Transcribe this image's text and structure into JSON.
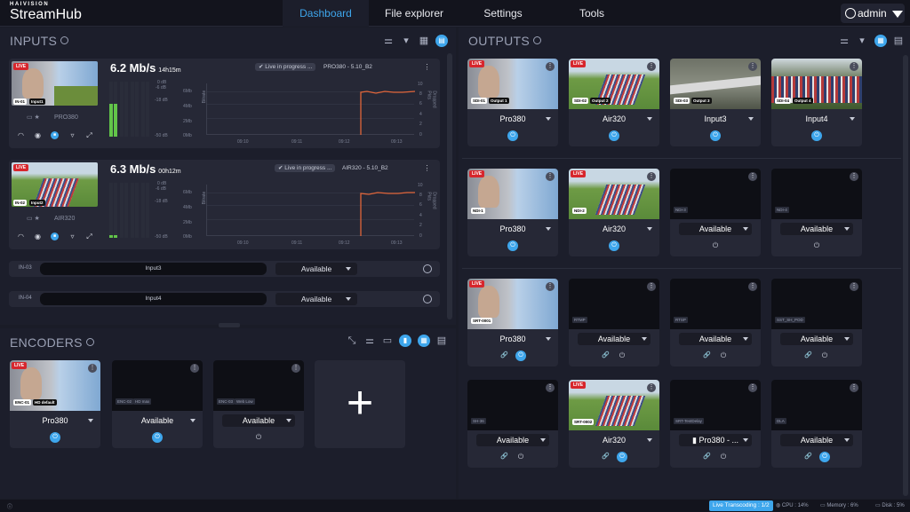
{
  "header": {
    "brand_top": "HAIVISION",
    "brand": "StreamHub",
    "tabs": [
      {
        "label": "Dashboard"
      },
      {
        "label": "File explorer"
      },
      {
        "label": "Settings"
      },
      {
        "label": "Tools"
      }
    ],
    "user": "admin"
  },
  "inputs": {
    "title": "INPUTS",
    "rows": [
      {
        "rate": "6.2 Mb/s",
        "dur": "14h15m",
        "status": "Live in progress ...",
        "device": "PRO380 - 5.10_B2",
        "id": "IN-01",
        "name": "Input1",
        "device_short": "PRO380",
        "db": [
          "0 dB",
          "-6 dB",
          "-18 dB",
          "-50 dB"
        ],
        "mb": [
          "6Mb",
          "4Mb",
          "2Mb",
          "0Mb"
        ],
        "right": [
          "10",
          "8",
          "6",
          "4",
          "2",
          "0"
        ],
        "times": [
          "09:10",
          "09:11",
          "09:12",
          "09:13"
        ],
        "yl": "Bitrate",
        "yr": "Dropped Pkts"
      },
      {
        "rate": "6.3 Mb/s",
        "dur": "00h12m",
        "status": "Live in progress ...",
        "device": "AIR320 - 5.10_B2",
        "id": "IN-02",
        "name": "Input2",
        "device_short": "AIR320",
        "db": [
          "0 dB",
          "-6 dB",
          "-18 dB",
          "-50 dB"
        ],
        "mb": [
          "6Mb",
          "4Mb",
          "2Mb",
          "0Mb"
        ],
        "right": [
          "10",
          "8",
          "6",
          "4",
          "2",
          "0"
        ],
        "times": [
          "09:10",
          "09:11",
          "09:12",
          "09:13"
        ],
        "yl": "Bitrate",
        "yr": "Dropped Pkts"
      }
    ],
    "slots": [
      {
        "id": "IN-03",
        "name": "Input3",
        "state": "Available"
      },
      {
        "id": "IN-04",
        "name": "Input4",
        "state": "Available"
      }
    ]
  },
  "encoders": {
    "title": "ENCODERS",
    "cards": [
      {
        "tag": "ENC-01",
        "sub": "HD default",
        "name": "Pro380"
      },
      {
        "tag": "ENC-02",
        "sub": "HD max",
        "name": "Available"
      },
      {
        "tag": "ENC-03",
        "sub": "Web Low",
        "name": "Available"
      }
    ],
    "add": "+"
  },
  "outputs": {
    "title": "OUTPUTS",
    "cards": [
      {
        "tag": "SDI-01",
        "sub": "Output 1",
        "name": "Pro380"
      },
      {
        "tag": "SDI-02",
        "sub": "Output 2",
        "name": "Air320"
      },
      {
        "tag": "SDI-03",
        "sub": "Output 3",
        "name": "Input3"
      },
      {
        "tag": "SDI-04",
        "sub": "Output 4",
        "name": "Input4"
      },
      {
        "tag": "NDI-1",
        "sub": "",
        "name": "Pro380"
      },
      {
        "tag": "NDI-2",
        "sub": "",
        "name": "Air320"
      },
      {
        "tag": "NDI-3",
        "sub": "",
        "name": "Available"
      },
      {
        "tag": "NDI-4",
        "sub": "",
        "name": "Available"
      },
      {
        "tag": "SRT-0001",
        "sub": "",
        "name": "Pro380"
      },
      {
        "tag": "RTMP",
        "sub": "",
        "name": "Available"
      },
      {
        "tag": "RTSP",
        "sub": "",
        "name": "Available"
      },
      {
        "tag": "SST_SH_POD",
        "sub": "",
        "name": "Available"
      },
      {
        "tag": "SH-36",
        "sub": "",
        "name": "Available"
      },
      {
        "tag": "SRT-0002",
        "sub": "",
        "name": "Air320"
      },
      {
        "tag": "SRT-TestDelay",
        "sub": "",
        "name": "Pro380 - ..."
      },
      {
        "tag": "DLA",
        "sub": "",
        "name": "Available"
      }
    ]
  },
  "footer": {
    "live": "Live Transcoding : 1/2",
    "cpu": "CPU : 14%",
    "mem": "Memory : 6%",
    "disk": "Disk : 5%"
  },
  "colors": {
    "accent": "#3ea6ec",
    "live": "#d7262c",
    "bitrate": "#e0653a",
    "meter": "#62c449"
  }
}
